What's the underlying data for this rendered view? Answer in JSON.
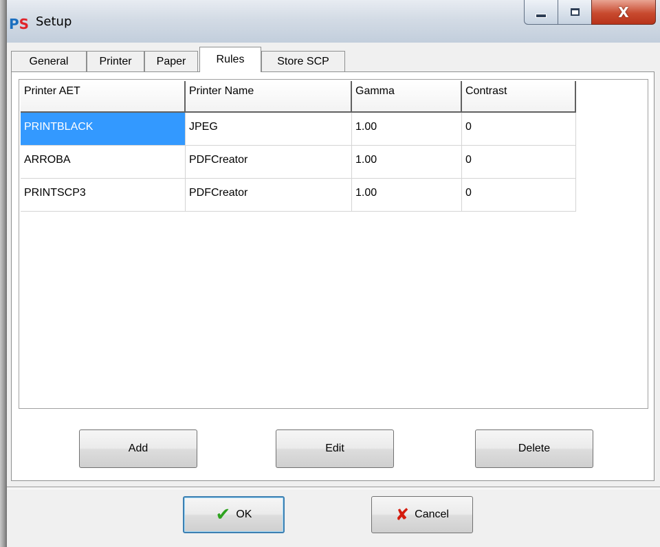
{
  "window": {
    "icon_text_a": "P",
    "icon_text_b": "S",
    "title": "Setup",
    "controls": {
      "minimize": "minimize-icon",
      "maximize": "maximize-icon",
      "close": "close-icon",
      "close_glyph": "X"
    }
  },
  "tabs": [
    {
      "label": "General",
      "active": false
    },
    {
      "label": "Printer",
      "active": false
    },
    {
      "label": "Paper",
      "active": false
    },
    {
      "label": "Rules",
      "active": true
    },
    {
      "label": "Store SCP",
      "active": false
    }
  ],
  "grid": {
    "columns": [
      "Printer AET",
      "Printer Name",
      "Gamma",
      "Contrast"
    ],
    "rows": [
      [
        "PRINTBLACK",
        "JPEG",
        "1.00",
        "0"
      ],
      [
        "ARROBA",
        "PDFCreator",
        "1.00",
        "0"
      ],
      [
        "PRINTSCP3",
        "PDFCreator",
        "1.00",
        "0"
      ]
    ],
    "selected_row": 0
  },
  "rule_buttons": {
    "add": "Add",
    "edit": "Edit",
    "delete": "Delete"
  },
  "dialog_buttons": {
    "ok": "OK",
    "cancel": "Cancel",
    "ok_icon": "✔",
    "cancel_icon": "✘"
  },
  "colors": {
    "selection": "#3399ff",
    "ok_check": "#2fa320",
    "cancel_x": "#d41c0e"
  }
}
